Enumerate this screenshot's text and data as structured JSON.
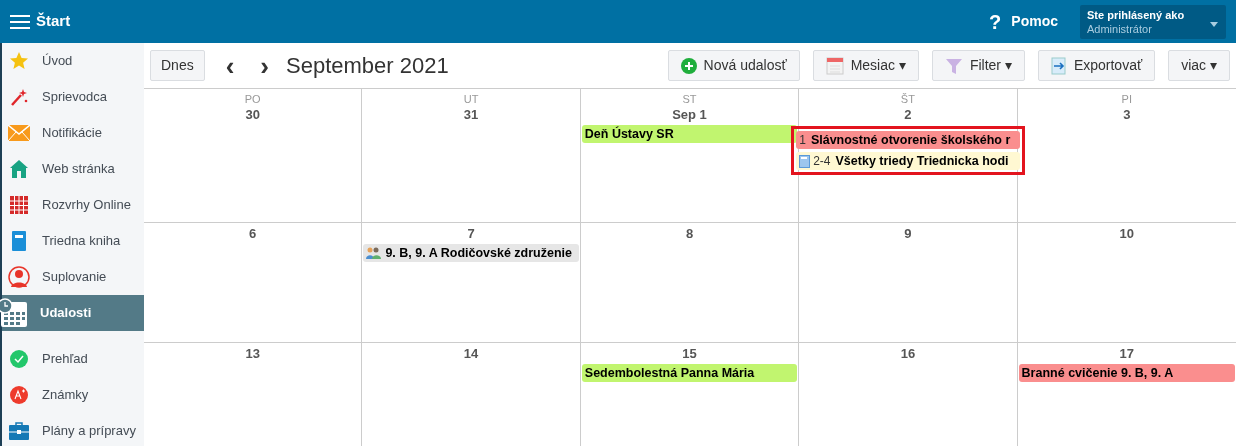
{
  "topbar": {
    "title": "Štart",
    "help_icon": "?",
    "help": "Pomoc",
    "user_label": "Ste prihlásený ako",
    "user_name": "Administrátor"
  },
  "sidebar": {
    "items": [
      {
        "label": "Úvod",
        "selected": false
      },
      {
        "label": "Sprievodca",
        "selected": false
      },
      {
        "label": "Notifikácie",
        "selected": false
      },
      {
        "label": "Web stránka",
        "selected": false
      },
      {
        "label": "Rozvrhy Online",
        "selected": false
      },
      {
        "label": "Triedna kniha",
        "selected": false
      },
      {
        "label": "Suplovanie",
        "selected": false
      },
      {
        "label": "Udalosti",
        "selected": true
      },
      {
        "label": "Prehľad",
        "selected": false
      },
      {
        "label": "Známky",
        "selected": false
      },
      {
        "label": "Plány a prípravy",
        "selected": false
      }
    ]
  },
  "toolbar": {
    "today": "Dnes",
    "prev": "‹",
    "next": "›",
    "title": "September 2021",
    "actions": [
      {
        "label": "Nová udalosť"
      },
      {
        "label": "Mesiac ▾"
      },
      {
        "label": "Filter ▾"
      },
      {
        "label": "Exportovať"
      },
      {
        "label": "viac ▾"
      }
    ]
  },
  "calendar": {
    "weekdays": [
      "PO",
      "UT",
      "ST",
      "ŠT",
      "PI"
    ],
    "weeks": [
      {
        "days": [
          {
            "date": "30",
            "highlighted": false
          },
          {
            "date": "31",
            "highlighted": false
          },
          {
            "date": "Sep 1",
            "highlighted": false,
            "events": [
              {
                "kind": "plain",
                "title": "Deň Ústavy SR",
                "color": "#c1f56f"
              }
            ]
          },
          {
            "date": "2",
            "highlighted": true,
            "events": [
              {
                "kind": "numbered",
                "number": "1",
                "title": "Slávnostné otvorenie školského r",
                "color": "#fa8e8e"
              },
              {
                "kind": "lesson",
                "number": "2-4",
                "title": "Všetky triedy Triednicka hodi",
                "color": "#fff8d2"
              }
            ]
          },
          {
            "date": "3",
            "highlighted": false
          }
        ]
      },
      {
        "days": [
          {
            "date": "6",
            "highlighted": false
          },
          {
            "date": "7",
            "highlighted": false,
            "events": [
              {
                "kind": "meeting",
                "title": "9. B, 9. A Rodičovské združenie",
                "color": "#e6e6e6"
              }
            ]
          },
          {
            "date": "8",
            "highlighted": false
          },
          {
            "date": "9",
            "highlighted": false
          },
          {
            "date": "10",
            "highlighted": false
          }
        ]
      },
      {
        "days": [
          {
            "date": "13",
            "highlighted": false
          },
          {
            "date": "14",
            "highlighted": false
          },
          {
            "date": "15",
            "highlighted": false,
            "events": [
              {
                "kind": "plain",
                "title": "Sedembolestná Panna Mária",
                "color": "#c1f56f"
              }
            ]
          },
          {
            "date": "16",
            "highlighted": false
          },
          {
            "date": "17",
            "highlighted": false,
            "events": [
              {
                "kind": "plain",
                "title": "Branné cvičenie 9. B, 9. A",
                "color": "#fa8e8e"
              }
            ]
          }
        ]
      }
    ]
  }
}
